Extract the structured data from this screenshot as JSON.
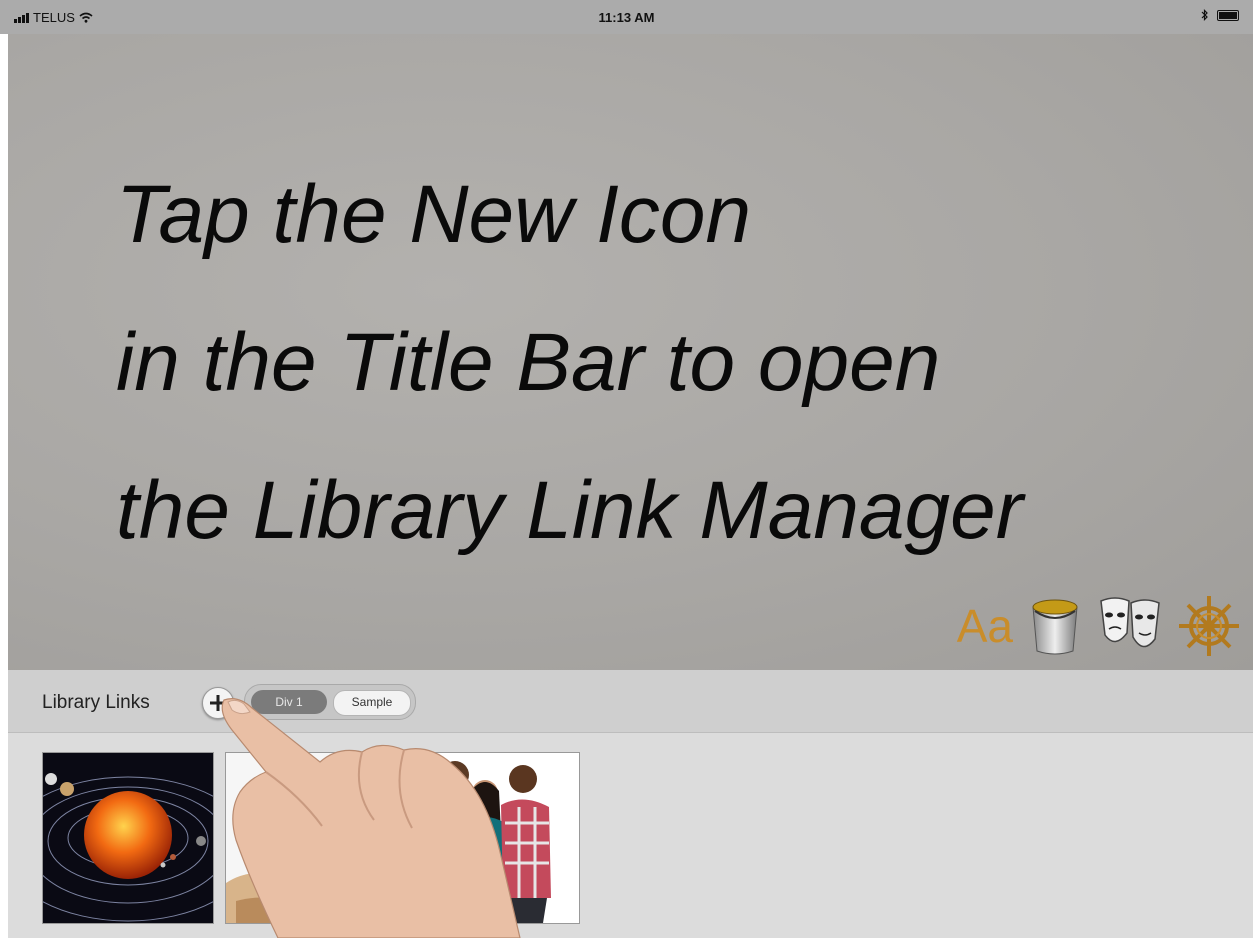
{
  "status_bar": {
    "carrier": "TELUS",
    "time": "11:13 AM"
  },
  "stage": {
    "lines": [
      "Tap the New Icon",
      "in the Title Bar to open",
      "the Library Link Manager"
    ],
    "tools": {
      "font_label": "Aa",
      "accent_color": "#c98d2b"
    }
  },
  "library": {
    "title": "Library Links",
    "tabs": [
      {
        "label": "Div 1",
        "selected": true
      },
      {
        "label": "Sample",
        "selected": false
      }
    ],
    "thumbnails": [
      {
        "icon": "solar-system-image"
      },
      {
        "icon": "portrait-image"
      },
      {
        "icon": "group-of-people-image"
      }
    ]
  }
}
